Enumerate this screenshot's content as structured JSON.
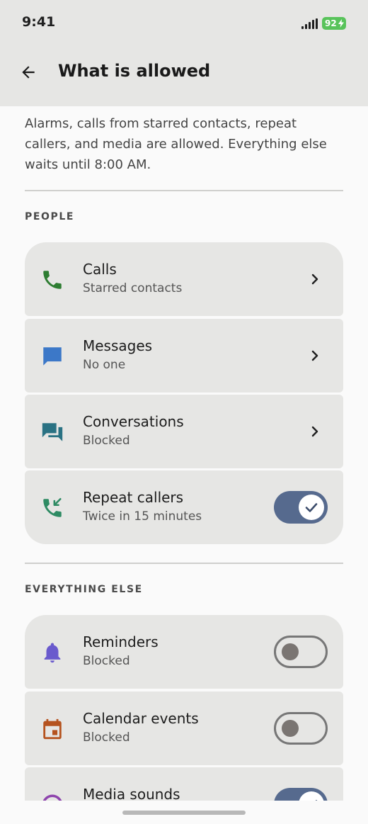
{
  "status_bar": {
    "time": "9:41",
    "battery": "92"
  },
  "app_bar": {
    "title": "What is allowed",
    "back_icon": "arrow-back-icon"
  },
  "description": "Alarms, calls from starred contacts, repeat callers, and media are allowed. Everything else waits until 8:00 AM.",
  "sections": {
    "people": {
      "header": "PEOPLE",
      "items": [
        {
          "title": "Calls",
          "subtitle": "Starred contacts",
          "icon": "phone-icon",
          "icon_color": "#2e7d32",
          "control": "chevron"
        },
        {
          "title": "Messages",
          "subtitle": "No one",
          "icon": "message-icon",
          "icon_color": "#3c78c8",
          "control": "chevron"
        },
        {
          "title": "Conversations",
          "subtitle": "Blocked",
          "icon": "conversation-icon",
          "icon_color": "#2a7283",
          "control": "chevron"
        },
        {
          "title": "Repeat callers",
          "subtitle": "Twice in 15 minutes",
          "icon": "phone-missed-icon",
          "icon_color": "#2e8b63",
          "control": "toggle",
          "enabled": true
        }
      ]
    },
    "everything_else": {
      "header": "EVERYTHING ELSE",
      "items": [
        {
          "title": "Reminders",
          "subtitle": "Blocked",
          "icon": "bell-icon",
          "icon_color": "#6a5acd",
          "control": "toggle",
          "enabled": false
        },
        {
          "title": "Calendar events",
          "subtitle": "Blocked",
          "icon": "calendar-icon",
          "icon_color": "#b5531f",
          "control": "toggle",
          "enabled": false
        },
        {
          "title": "Media sounds",
          "subtitle": "",
          "icon": "media-icon",
          "icon_color": "#8e44ad",
          "control": "toggle",
          "enabled": true
        }
      ]
    }
  },
  "colors": {
    "toggle_on": "#566a8e",
    "row_bg": "#e6e6e4",
    "header_bg": "#e6e6e4"
  }
}
